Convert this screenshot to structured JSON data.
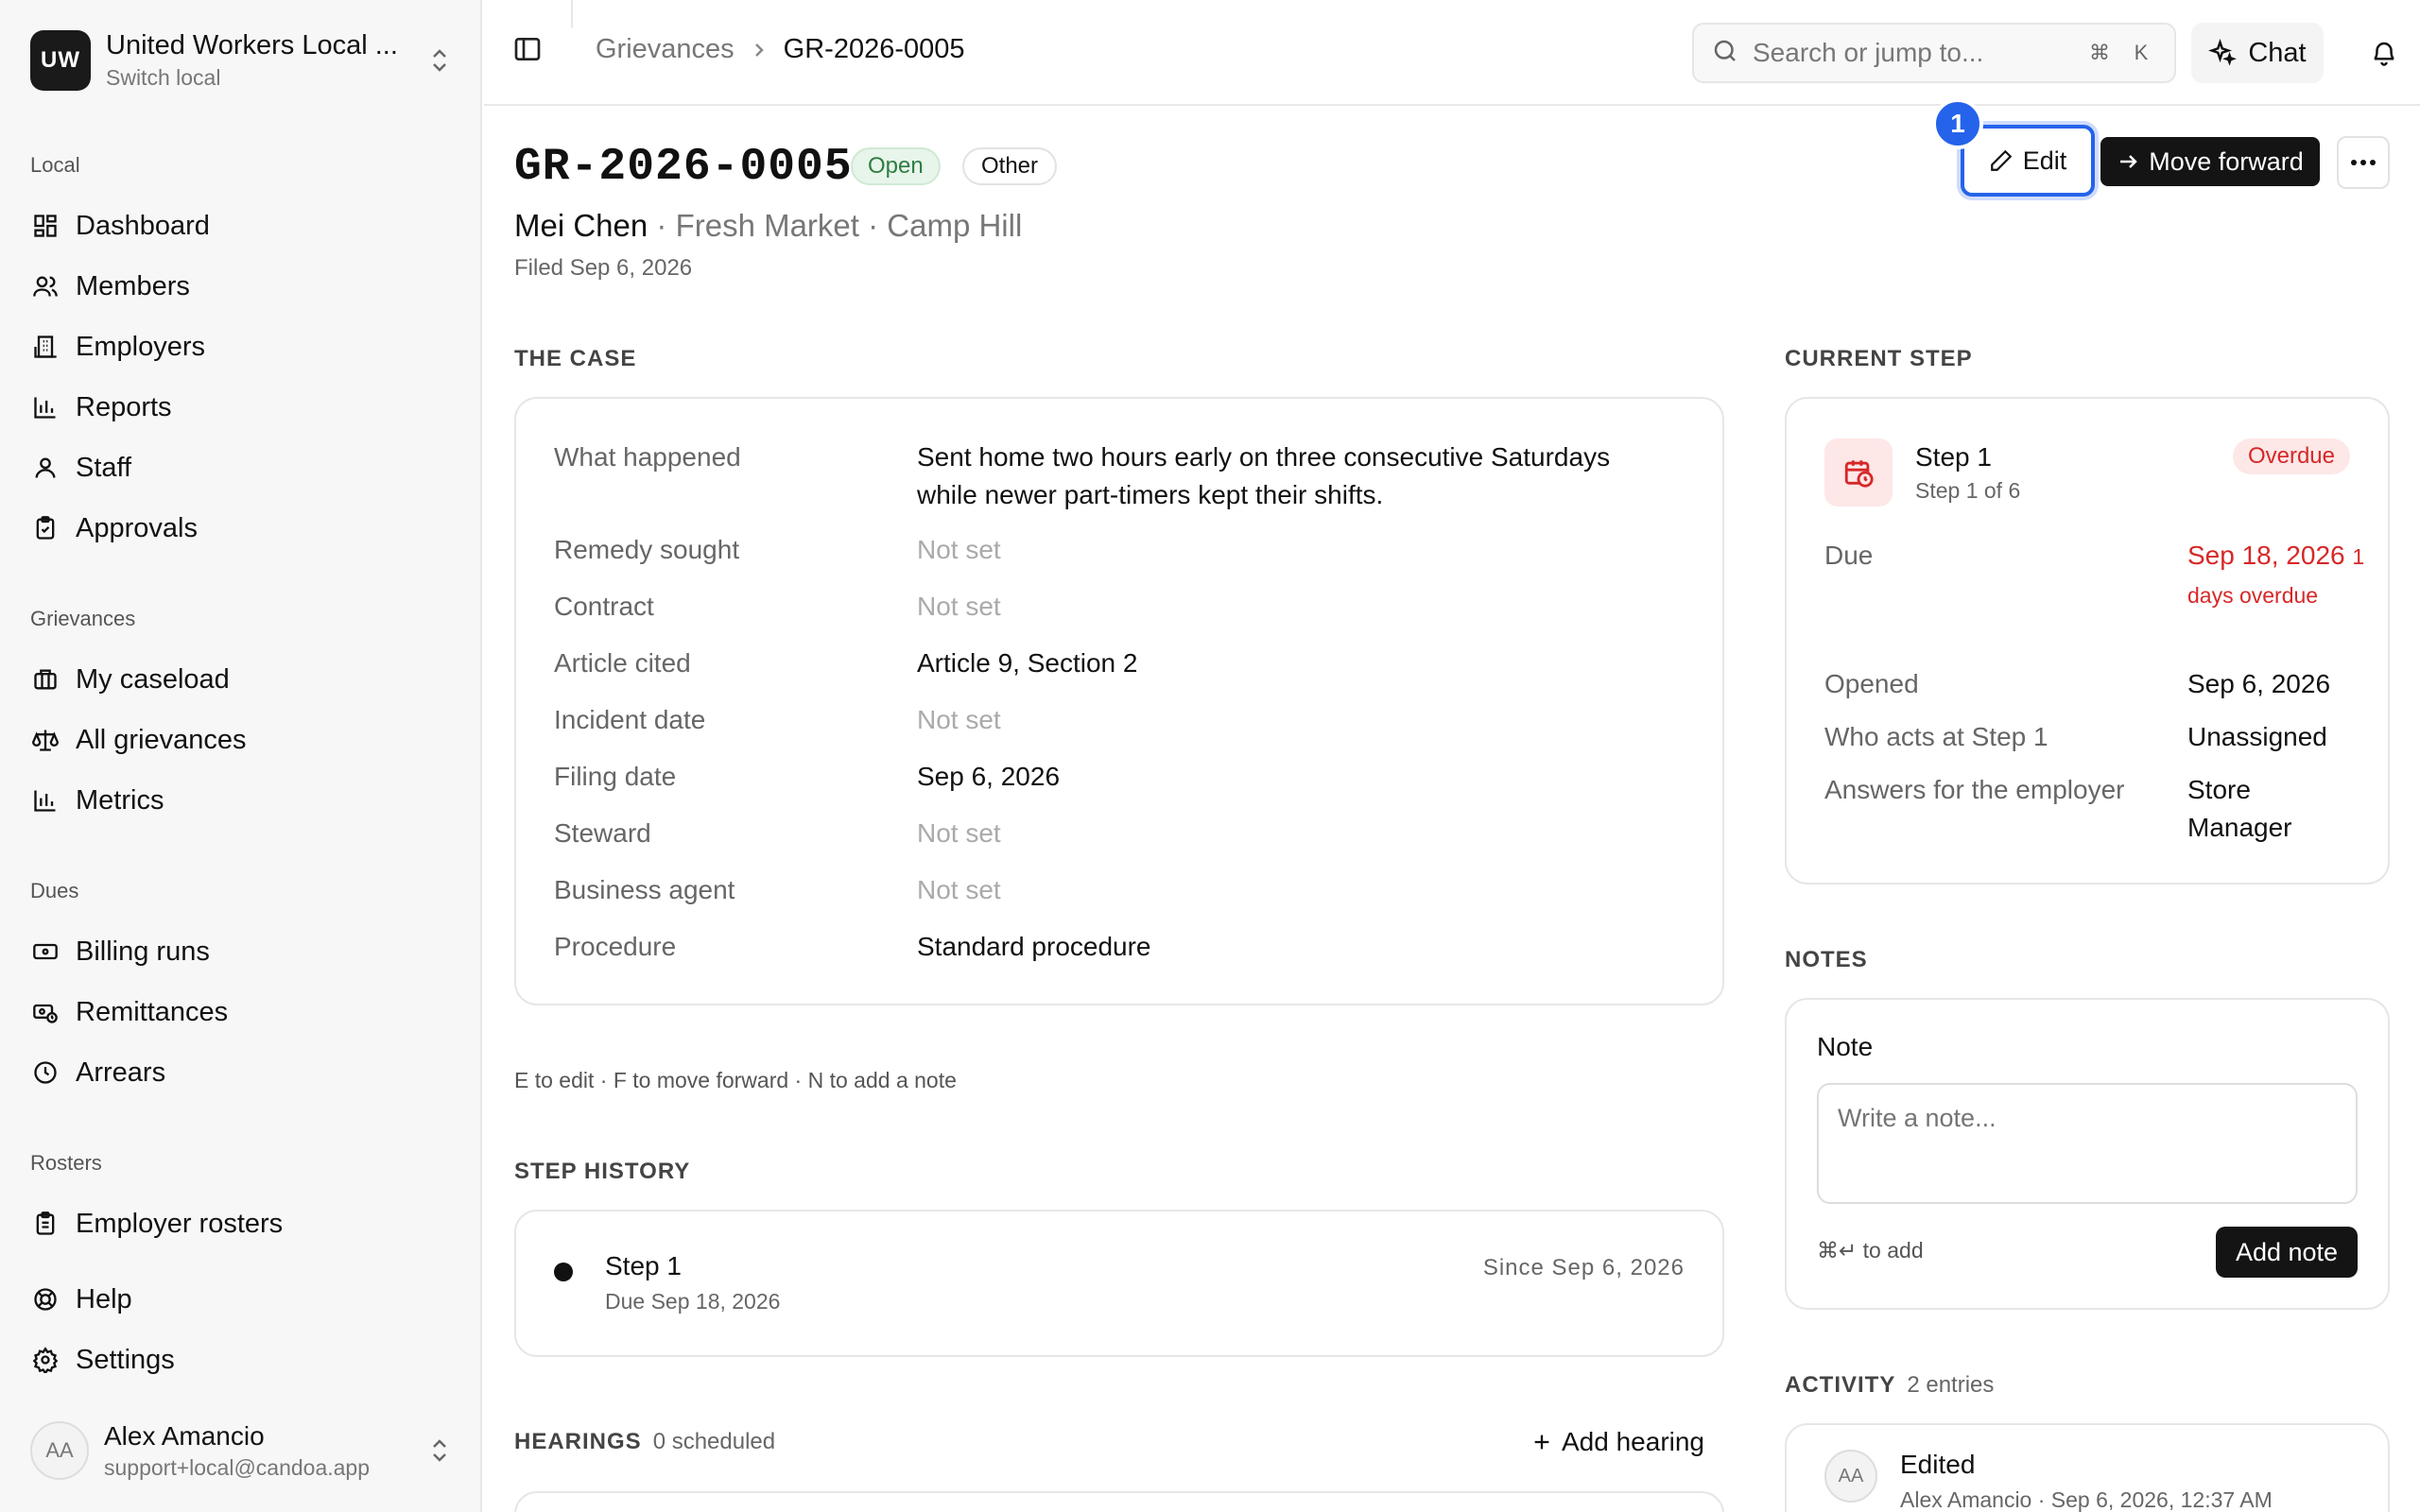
{
  "org": {
    "initials": "UW",
    "name": "United Workers Local ...",
    "switch_label": "Switch local"
  },
  "nav": {
    "local_title": "Local",
    "local": [
      "Dashboard",
      "Members",
      "Employers",
      "Reports",
      "Staff",
      "Approvals"
    ],
    "grievances_title": "Grievances",
    "grievances": [
      "My caseload",
      "All grievances",
      "Metrics"
    ],
    "dues_title": "Dues",
    "dues": [
      "Billing runs",
      "Remittances",
      "Arrears"
    ],
    "rosters_title": "Rosters",
    "rosters": [
      "Employer rosters"
    ],
    "bottom": [
      "Help",
      "Settings"
    ]
  },
  "user": {
    "initials": "AA",
    "name": "Alex Amancio",
    "email": "support+local@candoa.app"
  },
  "breadcrumb": {
    "parent": "Grievances",
    "current": "GR-2026-0005"
  },
  "search": {
    "placeholder": "Search or jump to...",
    "key1": "⌘",
    "key2": "K"
  },
  "chat_label": "Chat",
  "header": {
    "case_id": "GR-2026-0005",
    "status": "Open",
    "category": "Other",
    "member": "Mei Chen",
    "employer_loc": "· Fresh Market · Camp Hill",
    "filed": "Filed Sep 6, 2026",
    "marker": "1",
    "edit_label": "Edit",
    "move_label": "Move forward"
  },
  "the_case": {
    "title": "THE CASE",
    "rows": [
      {
        "label": "What happened",
        "value": "Sent home two hours early on three consecutive Saturdays while newer part-timers kept their shifts."
      },
      {
        "label": "Remedy sought",
        "value": "Not set"
      },
      {
        "label": "Contract",
        "value": "Not set"
      },
      {
        "label": "Article cited",
        "value": "Article 9, Section 2"
      },
      {
        "label": "Incident date",
        "value": "Not set"
      },
      {
        "label": "Filing date",
        "value": "Sep 6, 2026"
      },
      {
        "label": "Steward",
        "value": "Not set"
      },
      {
        "label": "Business agent",
        "value": "Not set"
      },
      {
        "label": "Procedure",
        "value": "Standard procedure"
      }
    ]
  },
  "shortcuts_hint": "E to edit · F to move forward · N to add a note",
  "step_history": {
    "title": "STEP HISTORY",
    "step": "Step 1",
    "due": "Due Sep 18, 2026",
    "since": "Since Sep 6, 2026"
  },
  "hearings": {
    "title": "HEARINGS",
    "count": "0 scheduled",
    "add_label": "Add hearing"
  },
  "current_step": {
    "title": "CURRENT STEP",
    "name": "Step 1",
    "of": "Step 1 of 6",
    "badge": "Overdue",
    "due_label": "Due",
    "due_date": "Sep 18, 2026",
    "due_overdue": "1 days overdue",
    "opened_label": "Opened",
    "opened_value": "Sep 6, 2026",
    "who_label": "Who acts at Step 1",
    "who_value": "Unassigned",
    "answers_label": "Answers for the employer",
    "answers_value": "Store Manager"
  },
  "notes": {
    "title": "NOTES",
    "label": "Note",
    "placeholder": "Write a note...",
    "hint": "⌘↵ to add",
    "add_label": "Add note"
  },
  "activity": {
    "title": "ACTIVITY",
    "count": "2 entries",
    "first_title": "Edited",
    "first_initials": "AA",
    "first_meta": "Alex Amancio · Sep 6, 2026, 12:37 AM"
  },
  "colors": {
    "accent": "#2563eb",
    "danger": "#d62828",
    "success": "#2e7d43",
    "dark": "#141414"
  }
}
